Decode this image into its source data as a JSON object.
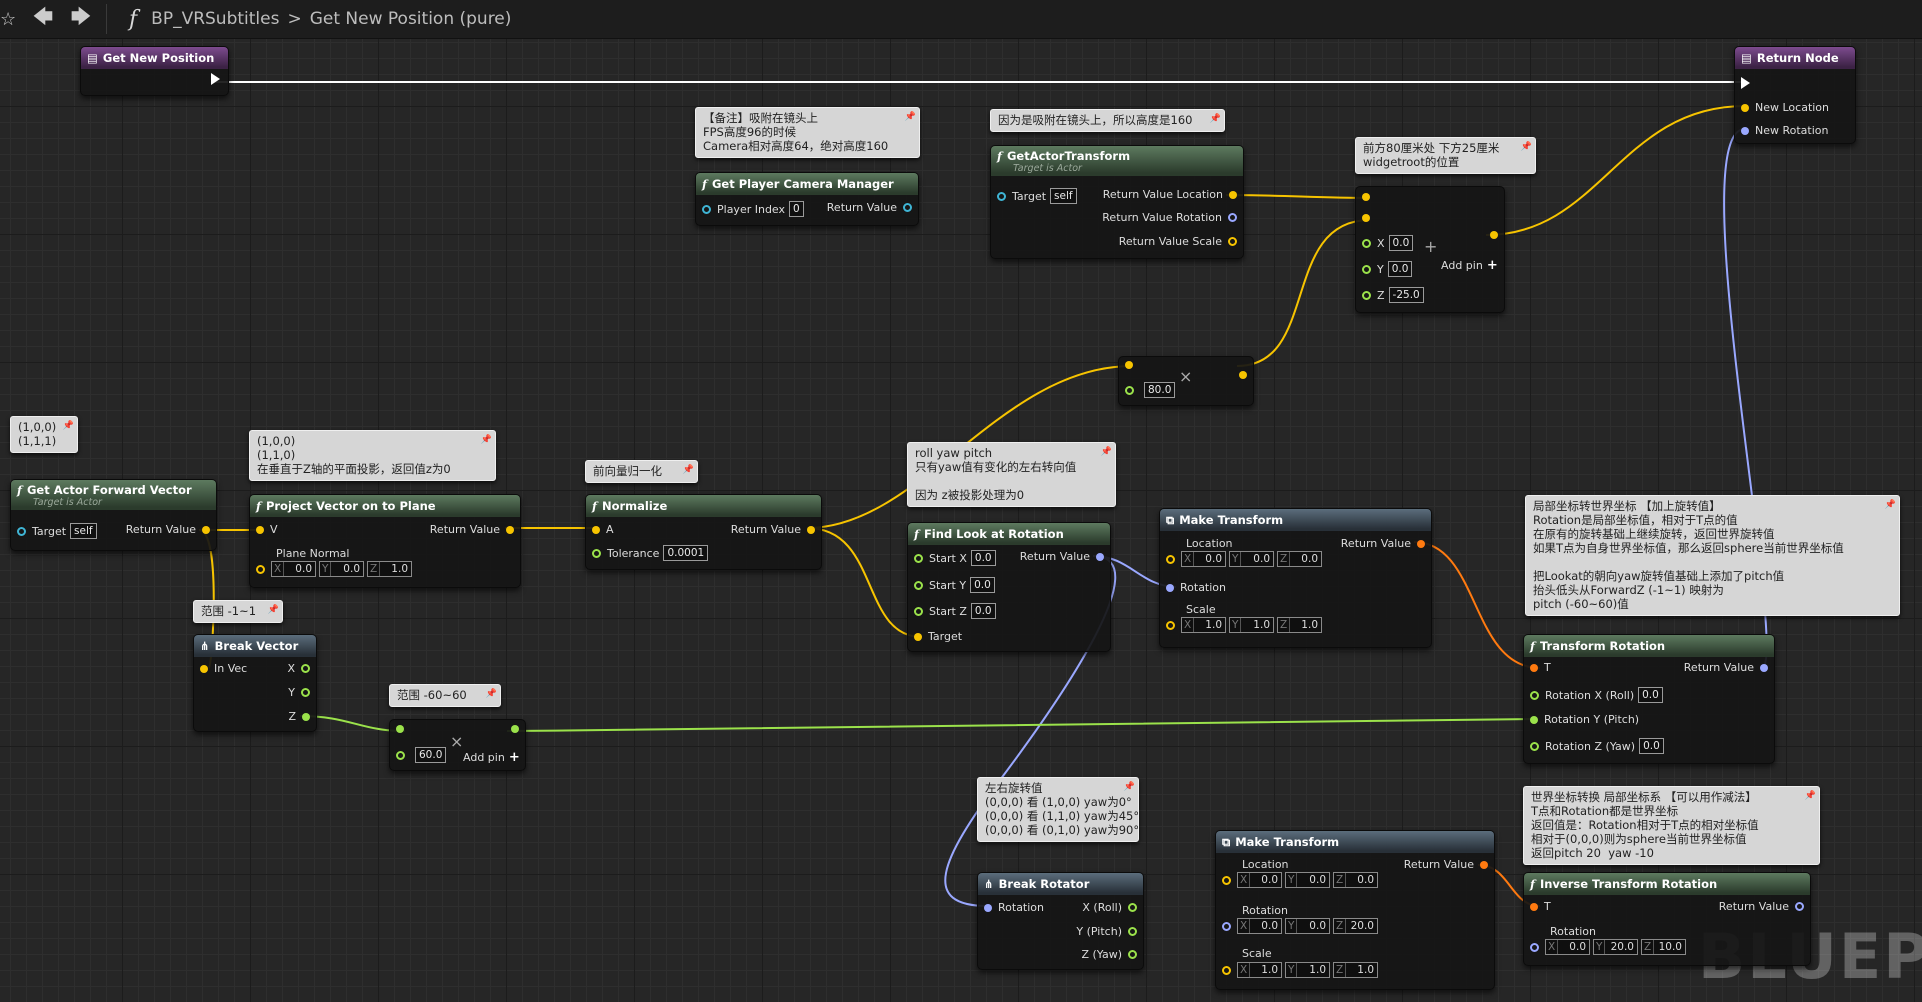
{
  "toolbar": {
    "star_icon": "star-icon",
    "back_icon": "arrow-left-icon",
    "forward_icon": "arrow-right-icon",
    "function_icon": "function-icon",
    "blueprint": "BP_VRSubtitles",
    "separator": ">",
    "function_name": "Get New Position (pure)"
  },
  "colors": {
    "exec": "#ffffff",
    "vector": "#f7c400",
    "float": "#9be24b",
    "rotator": "#9aa8ff",
    "transform": "#ff7a10",
    "object": "#3fb5d5"
  },
  "nodes": {
    "entry": {
      "title": "Get New Position"
    },
    "ret": {
      "title": "Return Node",
      "new_location": "New Location",
      "new_rotation": "New Rotation"
    },
    "gpcm": {
      "title": "Get Player Camera Manager",
      "player_index": "Player Index",
      "player_index_val": "0",
      "return_value": "Return Value"
    },
    "gat": {
      "title": "GetActorTransform",
      "subtitle": "Target is Actor",
      "target": "Target",
      "target_val": "self",
      "rv_location": "Return Value Location",
      "rv_rotation": "Return Value Rotation",
      "rv_scale": "Return Value Scale"
    },
    "addv": {
      "x": "X",
      "y": "Y",
      "z": "Z",
      "x_val": "0.0",
      "y_val": "0.0",
      "z_val": "-25.0",
      "add_pin": "Add pin"
    },
    "mult1": {
      "val": "80.0"
    },
    "gafv": {
      "title": "Get Actor Forward Vector",
      "subtitle": "Target is Actor",
      "target": "Target",
      "target_val": "self",
      "return_value": "Return Value"
    },
    "proj": {
      "title": "Project Vector on to Plane",
      "v": "V",
      "return_value": "Return Value",
      "plane_normal": "Plane Normal",
      "x": "X",
      "y": "Y",
      "z": "Z",
      "x_val": "0.0",
      "y_val": "0.0",
      "z_val": "1.0"
    },
    "norm": {
      "title": "Normalize",
      "a": "A",
      "return_value": "Return Value",
      "tolerance": "Tolerance",
      "tolerance_val": "0.0001"
    },
    "fla": {
      "title": "Find Look at Rotation",
      "start_x": "Start X",
      "start_y": "Start Y",
      "start_z": "Start Z",
      "sx_val": "0.0",
      "sy_val": "0.0",
      "sz_val": "0.0",
      "target": "Target",
      "return_value": "Return Value"
    },
    "mt1": {
      "title": "Make Transform",
      "location": "Location",
      "return_value": "Return Value",
      "rotation": "Rotation",
      "scale": "Scale",
      "x": "X",
      "y": "Y",
      "z": "Z",
      "lx": "0.0",
      "ly": "0.0",
      "lz": "0.0",
      "sx": "1.0",
      "sy": "1.0",
      "sz": "1.0"
    },
    "tr": {
      "title": "Transform Rotation",
      "t": "T",
      "return_value": "Return Value",
      "rot_x": "Rotation X (Roll)",
      "rot_x_val": "0.0",
      "rot_y": "Rotation Y (Pitch)",
      "rot_z": "Rotation Z (Yaw)",
      "rot_z_val": "0.0"
    },
    "brk": {
      "title": "Break Vector",
      "in_vec": "In Vec",
      "x": "X",
      "y": "Y",
      "z": "Z"
    },
    "mult2": {
      "val": "60.0",
      "add_pin": "Add pin"
    },
    "brot": {
      "title": "Break Rotator",
      "rotation": "Rotation",
      "x": "X (Roll)",
      "y": "Y (Pitch)",
      "z": "Z (Yaw)"
    },
    "mt2": {
      "title": "Make Transform",
      "location": "Location",
      "return_value": "Return Value",
      "rotation": "Rotation",
      "scale": "Scale",
      "x": "X",
      "y": "Y",
      "z": "Z",
      "lx": "0.0",
      "ly": "0.0",
      "lz": "0.0",
      "rx": "0.0",
      "ry": "0.0",
      "rz": "20.0",
      "sx": "1.0",
      "sy": "1.0",
      "sz": "1.0"
    },
    "itr": {
      "title": "Inverse Transform Rotation",
      "t": "T",
      "return_value": "Return Value",
      "rotation": "Rotation",
      "x": "X",
      "y": "Y",
      "z": "Z",
      "rx": "0.0",
      "ry": "20.0",
      "rz": "10.0"
    }
  },
  "comments": {
    "c_camera": "【备注】吸附在镜头上\nFPS高度96的时候\nCamera相对高度64，绝对高度160",
    "c_height": "因为是吸附在镜头上，所以高度是160",
    "c_front": "前方80厘米处 下方25厘米\nwidgetroot的位置",
    "c_vec": "(1,0,0)\n(1,1,1)",
    "c_proj": "(1,0,0)\n(1,1,0)\n在垂直于Z轴的平面投影，返回值z为0",
    "c_norm": "前向量归一化",
    "c_roll": "roll yaw pitch\n只有yaw值有变化的左右转向值\n\n因为 z被投影处理为0",
    "c_range1": "范围 -1~1",
    "c_range2": "范围 -60~60",
    "c_local": "局部坐标转世界坐标 【加上旋转值】\nRotation是局部坐标值，相对于T点的值\n在原有的旋转基础上继续旋转，返回世界旋转值\n如果T点为自身世界坐标值，那么返回sphere当前世界坐标值\n\n把Lookat的朝向yaw旋转值基础上添加了pitch值\n抬头低头从ForwardZ (-1~1) 映射为\npitch (-60~60)值",
    "c_yaw": "左右旋转值\n(0,0,0) 看 (1,0,0) yaw为0°\n(0,0,0) 看 (1,1,0) yaw为45°\n(0,0,0) 看 (0,1,0) yaw为90°",
    "c_world": "世界坐标转换 局部坐标系 【可以用作减法】\nT点和Rotation都是世界坐标\n返回值是：Rotation相对于T点的相对坐标值\n相对于(0,0,0)则为sphere当前世界坐标值\n返回pitch 20  yaw -10"
  },
  "watermark": "BLUEPRI"
}
